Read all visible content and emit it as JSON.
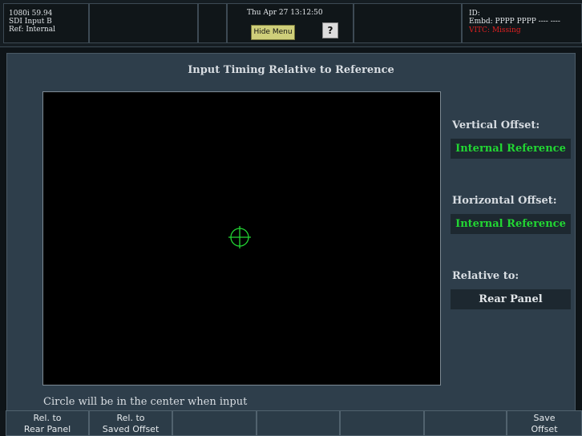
{
  "status": {
    "format": "1080i 59.94",
    "input": "SDI Input B",
    "ref": "Ref: Internal",
    "datetime": "Thu Apr 27 13:12:50",
    "hide_menu": "Hide Menu",
    "help": "?",
    "id_label": "ID:",
    "embd": "Embd: PPPP PPPP ---- ----",
    "vitc": "VITC: Missing"
  },
  "panel": {
    "title": "Input Timing Relative to Reference",
    "vertical_offset_label": "Vertical Offset:",
    "vertical_offset_value": "Internal Reference",
    "horizontal_offset_label": "Horizontal Offset:",
    "horizontal_offset_value": "Internal Reference",
    "relative_to_label": "Relative to:",
    "relative_to_value": "Rear Panel",
    "note": "Circle will be in the center when input"
  },
  "softkeys": [
    {
      "line1": "Rel. to",
      "line2": "Rear Panel"
    },
    {
      "line1": "Rel. to",
      "line2": "Saved Offset"
    },
    {
      "line1": "",
      "line2": ""
    },
    {
      "line1": "",
      "line2": ""
    },
    {
      "line1": "",
      "line2": ""
    },
    {
      "line1": "",
      "line2": ""
    },
    {
      "line1": "Save",
      "line2": "Offset"
    }
  ],
  "colors": {
    "value_green": "#22d633",
    "vitc_red": "#e02020",
    "hide_menu_bg": "#cfcf7a"
  }
}
